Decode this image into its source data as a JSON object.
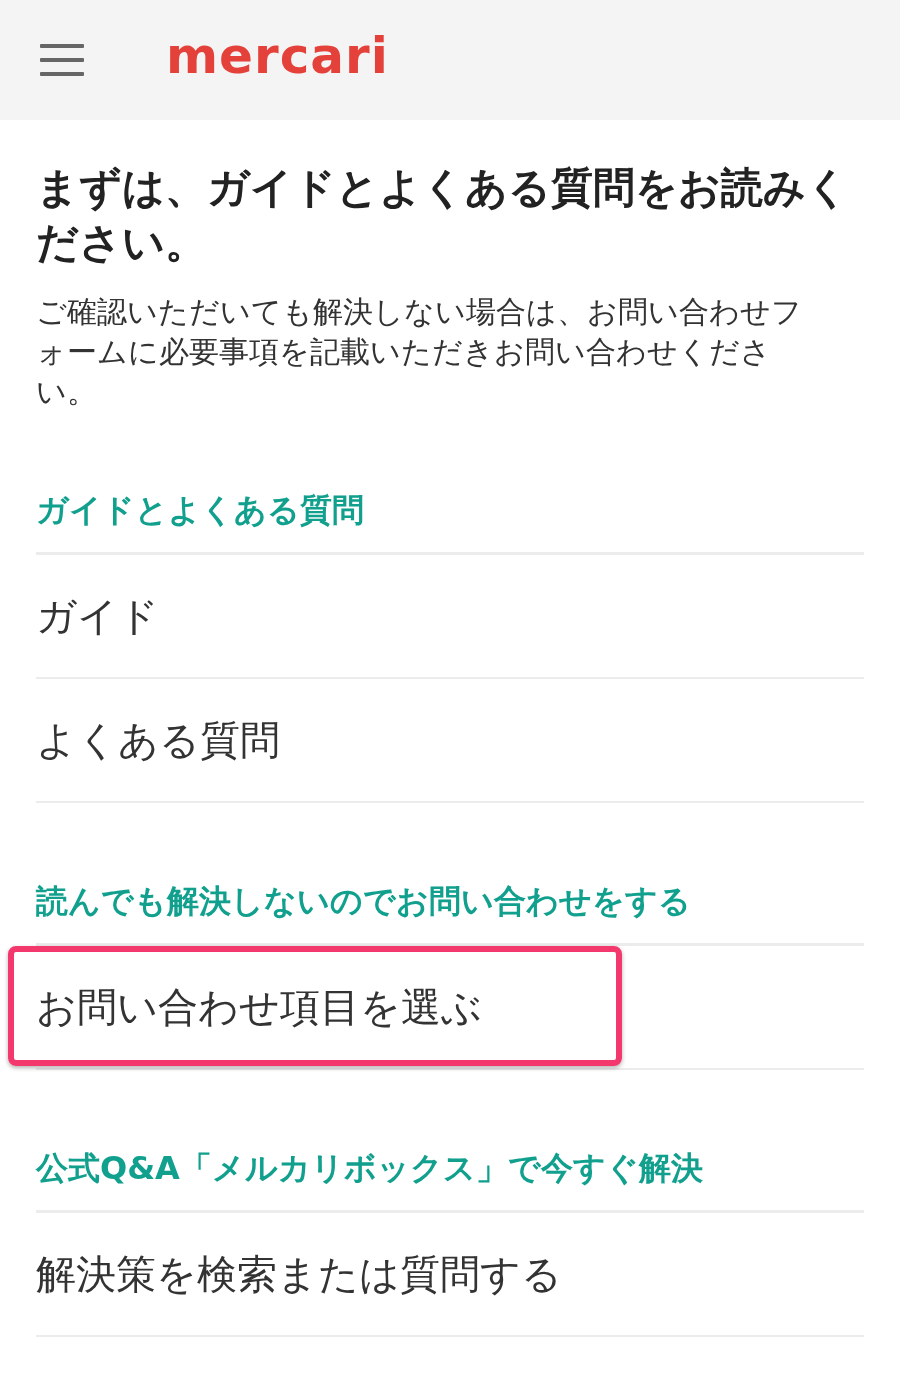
{
  "header": {
    "logo": "mercari"
  },
  "intro": {
    "title": "まずは、ガイドとよくある質問をお読みください。",
    "body": "ご確認いただいても解決しない場合は、お問い合わせフォームに必要事項を記載いただきお問い合わせください。"
  },
  "sections": [
    {
      "heading": "ガイドとよくある質問",
      "items": [
        {
          "label": "ガイド",
          "highlighted": false
        },
        {
          "label": "よくある質問",
          "highlighted": false
        }
      ]
    },
    {
      "heading": "読んでも解決しないのでお問い合わせをする",
      "items": [
        {
          "label": "お問い合わせ項目を選ぶ",
          "highlighted": true
        }
      ]
    },
    {
      "heading": "公式Q&A「メルカリボックス」で今すぐ解決",
      "items": [
        {
          "label": "解決策を検索または質問する",
          "highlighted": false
        }
      ]
    }
  ]
}
